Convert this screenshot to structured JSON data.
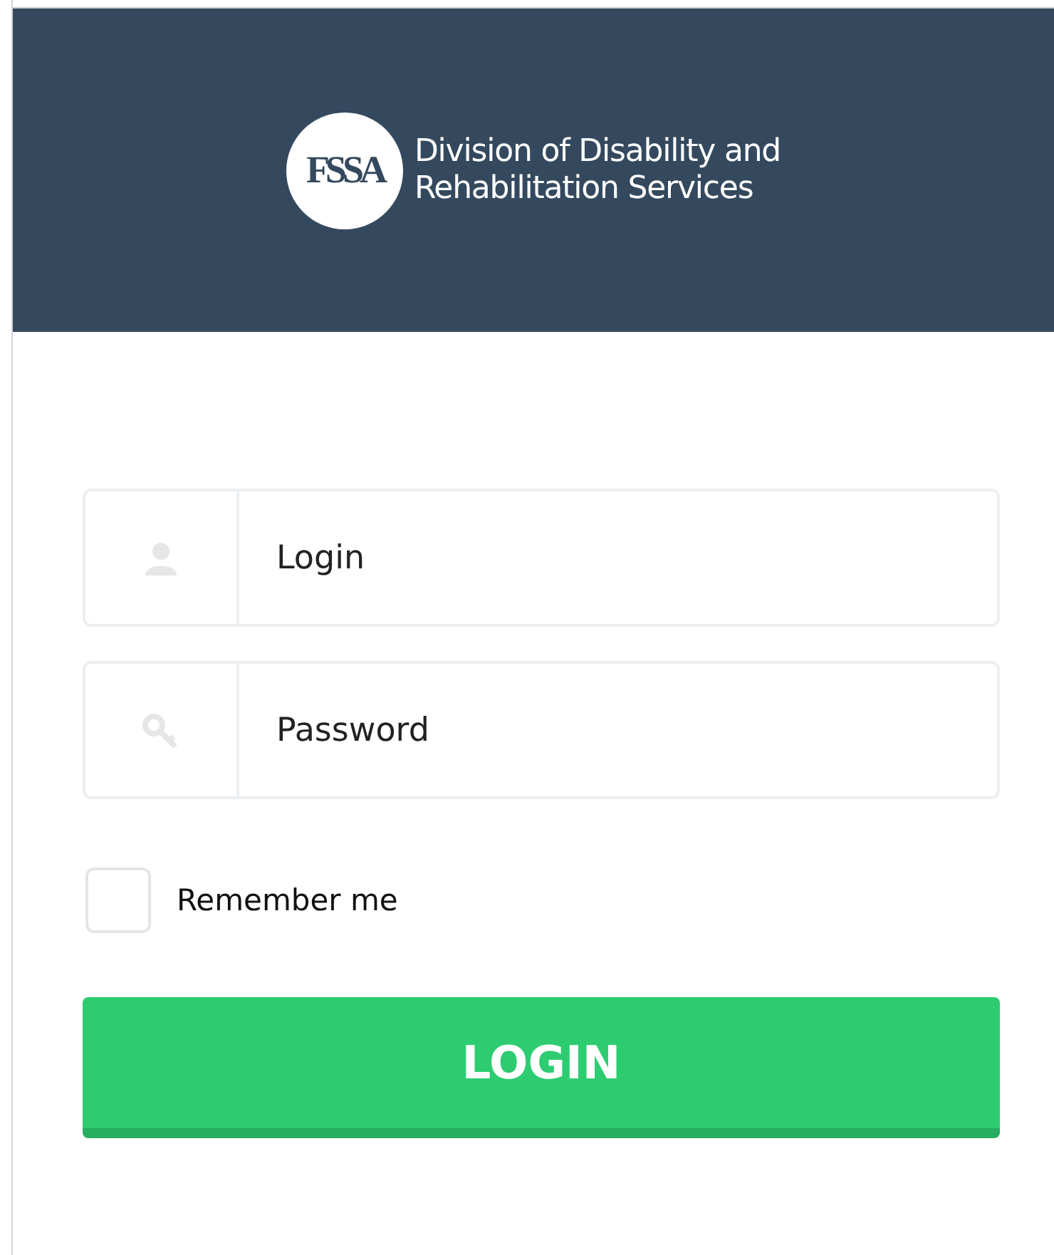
{
  "header": {
    "logo_text": "FSSA",
    "title_lines": [
      "Division of Disability and",
      "Rehabilitation Services"
    ]
  },
  "fields": [
    {
      "kind": "user",
      "placeholder": "Login"
    },
    {
      "kind": "password",
      "placeholder": "Password"
    }
  ],
  "remember": {
    "label": "Remember me",
    "checked": false
  },
  "login_button": "LOGIN"
}
